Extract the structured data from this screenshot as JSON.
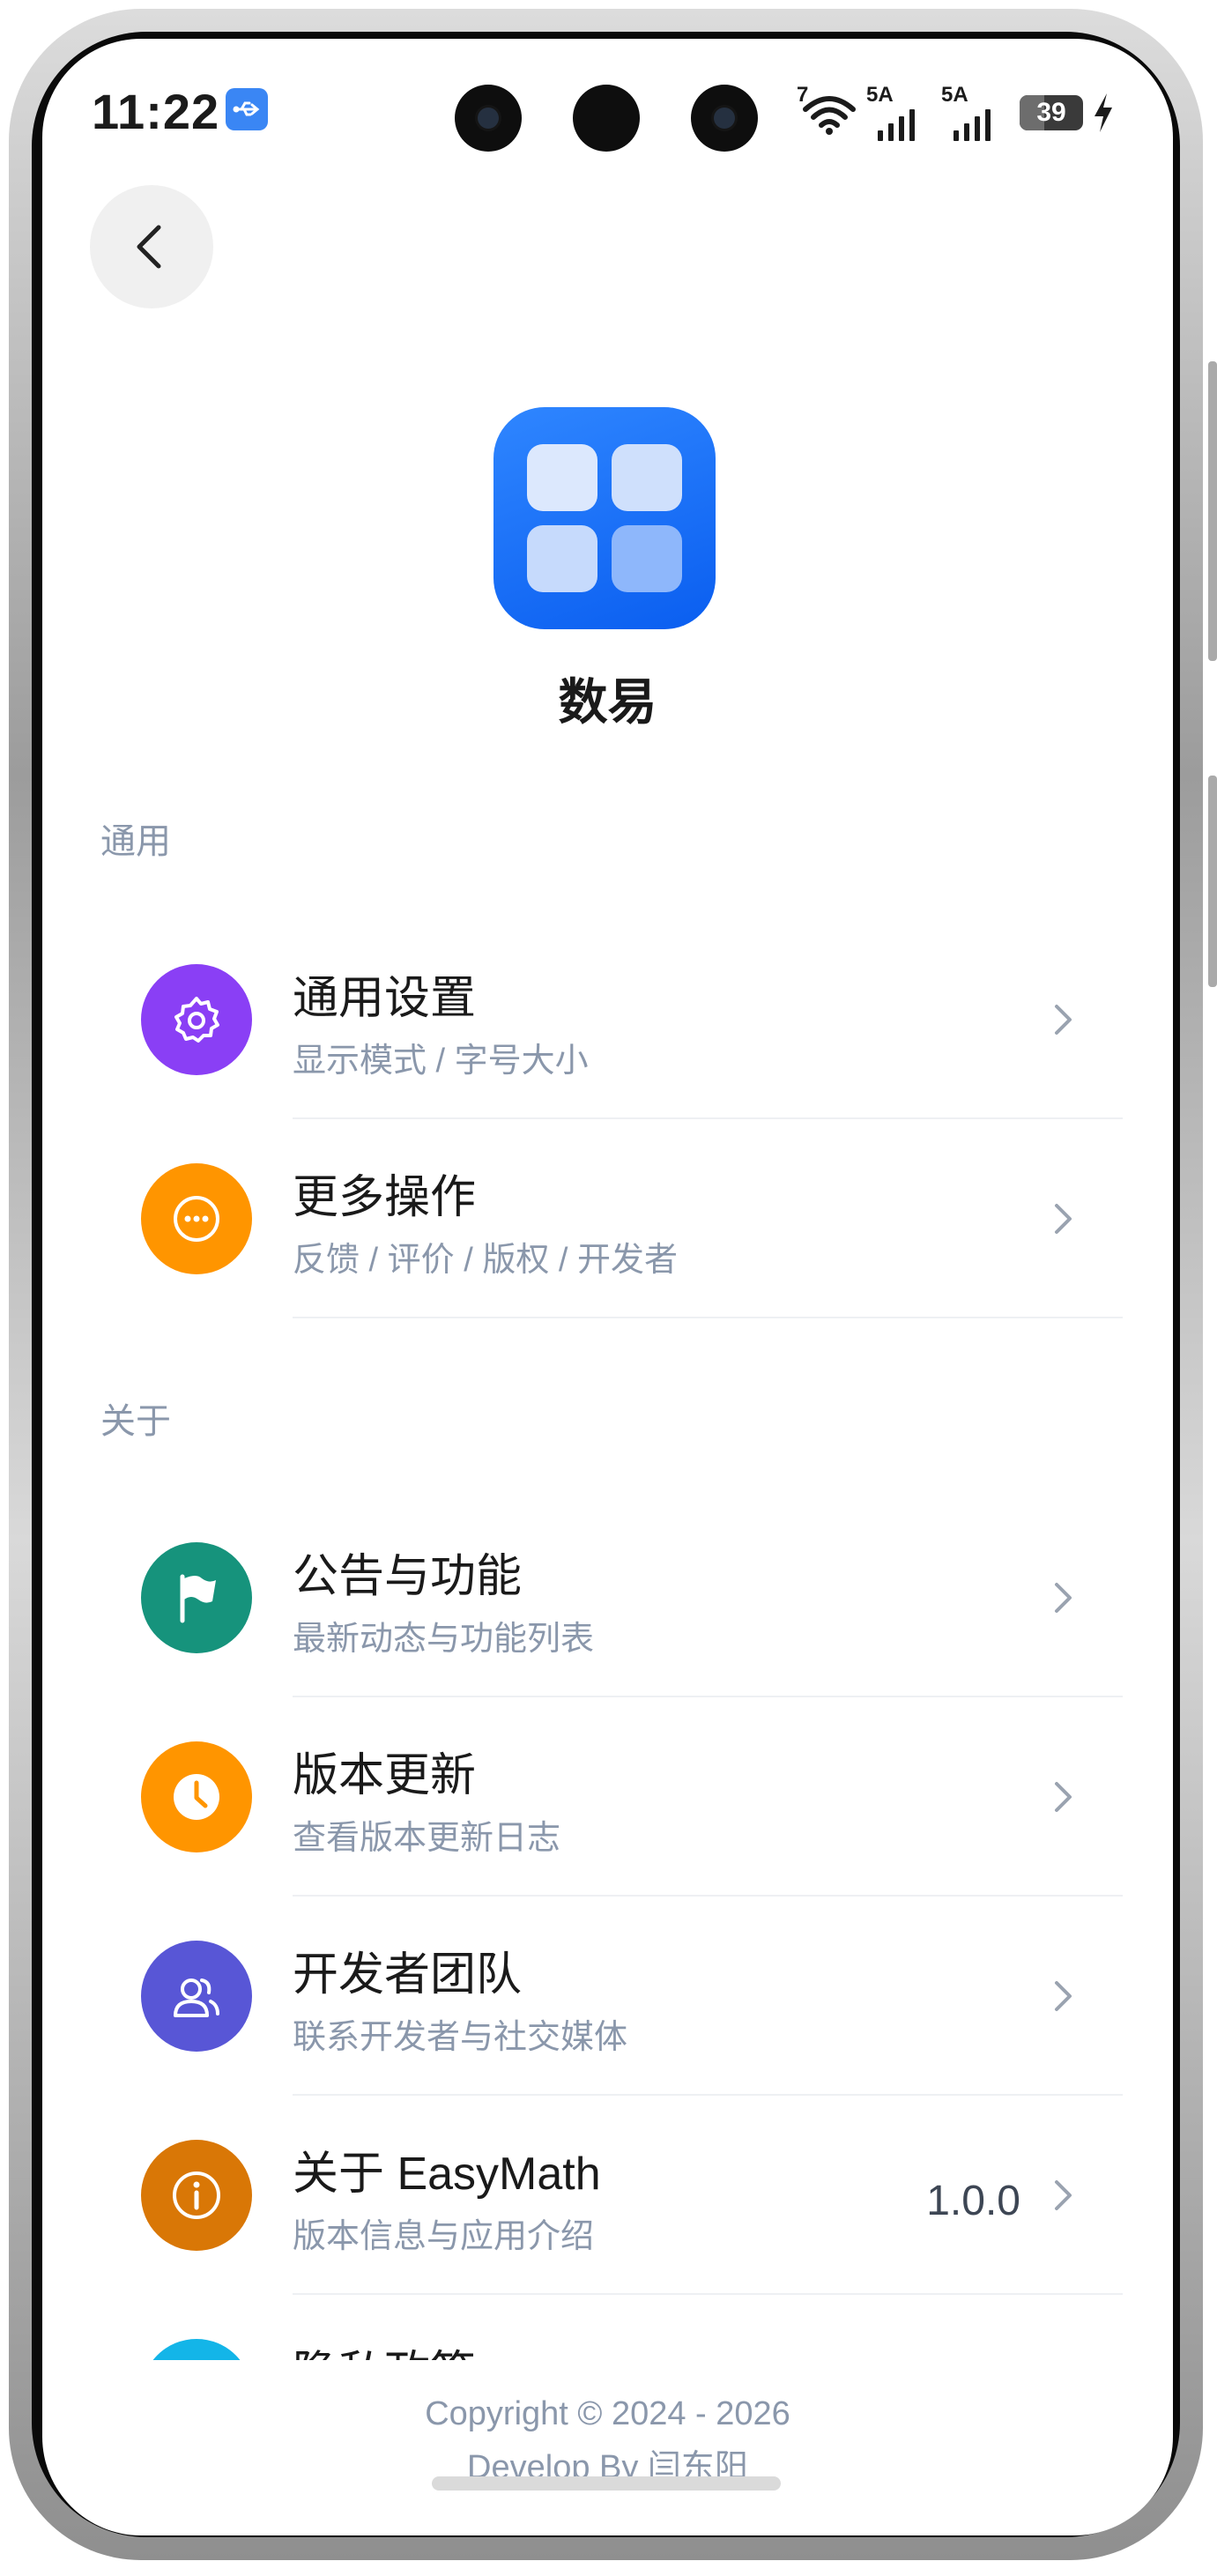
{
  "status_bar": {
    "time": "11:22",
    "net_primary": "7",
    "sim1_label": "5A",
    "sim2_label": "5A",
    "battery_level": 39,
    "battery_text": "39",
    "icons": [
      "usb-icon",
      "wifi-icon",
      "signal-icon",
      "battery-icon",
      "charging-icon"
    ]
  },
  "header": {
    "back_icon": "chevron-left-icon",
    "app_name": "数易",
    "logo_icon": "grid-four-squares-icon"
  },
  "sections": [
    {
      "label": "通用",
      "items": [
        {
          "title": "通用设置",
          "subtitle": "显示模式 / 字号大小",
          "icon": "gear-icon",
          "color": "#8a3ff5"
        },
        {
          "title": "更多操作",
          "subtitle": "反馈 / 评价 / 版权 / 开发者",
          "icon": "more-dots-icon",
          "color": "#ff9500"
        }
      ]
    },
    {
      "label": "关于",
      "items": [
        {
          "title": "公告与功能",
          "subtitle": "最新动态与功能列表",
          "icon": "flag-icon",
          "color": "#16937c"
        },
        {
          "title": "版本更新",
          "subtitle": "查看版本更新日志",
          "icon": "clock-icon",
          "color": "#ff9500"
        },
        {
          "title": "开发者团队",
          "subtitle": "联系开发者与社交媒体",
          "icon": "team-icon",
          "color": "#5856d6"
        },
        {
          "title": "关于 EasyMath",
          "subtitle": "版本信息与应用介绍",
          "icon": "info-icon",
          "color": "#d97706",
          "value": "1.0.0"
        },
        {
          "title": "隐私政策",
          "icon": "shield-icon",
          "color": "#13b5e8"
        }
      ]
    }
  ],
  "footer": {
    "copyright": "Copyright © 2024 - 2026",
    "developer": "Develop By 闫东阳"
  },
  "colors": {
    "accent_blue": "#1a6ff5",
    "secondary_text": "#8a97ab",
    "primary_text": "#1a1a1a"
  }
}
